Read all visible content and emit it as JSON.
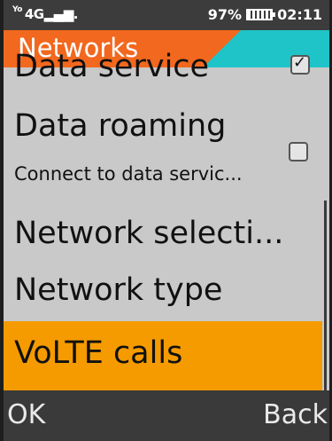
{
  "status_bar": {
    "left_indicator": "Yo",
    "network": "4G",
    "battery_percent": "97%",
    "time": "02:11",
    "icons": [
      "volte-icon",
      "signal-icon",
      "battery-icon"
    ]
  },
  "header": {
    "title": "Networks",
    "accent_primary": "#f2681e",
    "accent_secondary": "#1fc4c8"
  },
  "list": {
    "items": [
      {
        "label": "Data service",
        "checkbox": true,
        "checked": true
      },
      {
        "label": "Data roaming",
        "sub": "Connect to data servic...",
        "checkbox": true,
        "checked": false
      },
      {
        "label": "Network selecti..."
      },
      {
        "label": "Network type"
      },
      {
        "label": "VoLTE calls",
        "selected": true
      }
    ],
    "selection_color": "#f59b00"
  },
  "softkeys": {
    "left": "OK",
    "right": "Back"
  }
}
